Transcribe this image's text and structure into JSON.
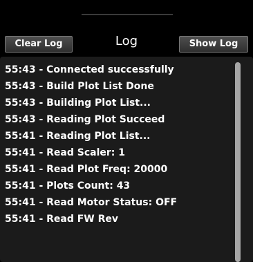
{
  "header": {
    "clear_log_label": "Clear Log",
    "title": "Log",
    "show_log_label": "Show Log"
  },
  "log": {
    "entries": [
      "55:43 - Connected successfully",
      "55:43 - Build Plot List Done",
      "55:43 - Building Plot List...",
      "55:43 - Reading Plot Succeed",
      "55:41 - Reading Plot List...",
      "55:41 - Read Scaler: 1",
      "55:41 - Read Plot Freq: 20000",
      "55:41 - Plots Count: 43",
      "55:41 - Read Motor Status: OFF",
      "55:41 - Read FW Rev"
    ]
  },
  "colors": {
    "background": "#000000",
    "panel": "#1b1b1b",
    "text": "#ffffff",
    "scrollbar_thumb": "#a6a6a6"
  }
}
